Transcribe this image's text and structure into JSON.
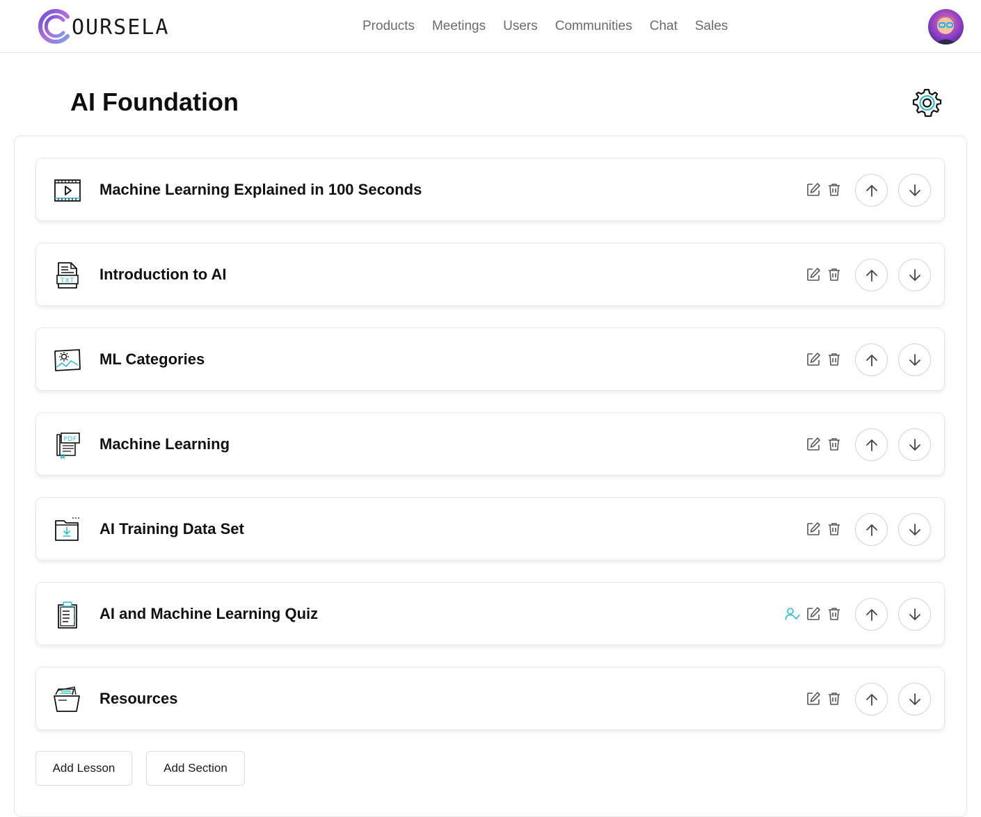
{
  "brand": {
    "name": "OURSELA",
    "logo_icon": "c-ring-logo-icon"
  },
  "nav": [
    "Products",
    "Meetings",
    "Users",
    "Communities",
    "Chat",
    "Sales"
  ],
  "user": {
    "avatar_icon": "user-avatar"
  },
  "page": {
    "title": "AI Foundation",
    "settings_icon": "gear-icon"
  },
  "lessons": [
    {
      "title": "Machine Learning Explained in 100 Seconds",
      "type_icon": "video-icon",
      "assign": false
    },
    {
      "title": "Introduction to AI",
      "type_icon": "txt-file-icon",
      "assign": false
    },
    {
      "title": "ML Categories",
      "type_icon": "image-icon",
      "assign": false
    },
    {
      "title": "Machine Learning",
      "type_icon": "pdf-file-icon",
      "assign": false
    },
    {
      "title": "AI Training Data Set",
      "type_icon": "folder-download-icon",
      "assign": false
    },
    {
      "title": "AI and Machine Learning Quiz",
      "type_icon": "quiz-clipboard-icon",
      "assign": true
    },
    {
      "title": "Resources",
      "type_icon": "resources-folder-icon",
      "assign": false
    }
  ],
  "actions": {
    "add_lesson": "Add Lesson",
    "add_section": "Add Section"
  },
  "colors": {
    "accent_teal": "#2bbbd1",
    "logo_purple": "#8e5bd6",
    "text_dark": "#111111",
    "nav_gray": "#6b6b6b"
  }
}
